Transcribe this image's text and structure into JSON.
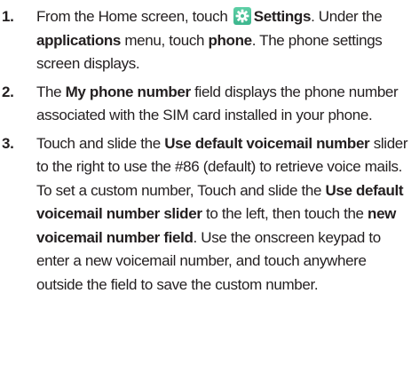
{
  "steps": [
    {
      "number": "1.",
      "t1": "From the Home screen, touch ",
      "b1": "Settings",
      "t2": ". Under the ",
      "b2": "applications",
      "t3": " menu, touch ",
      "b3": "phone",
      "t4": ". The phone settings screen displays."
    },
    {
      "number": "2.",
      "t1": "The ",
      "b1": "My phone number",
      "t2": " field displays the phone number associated with the SIM card installed in your phone."
    },
    {
      "number": "3.",
      "t1": "Touch and slide the ",
      "b1": "Use default voicemail number",
      "t2": " slider to the right to use the #86 (default) to retrieve voice mails. To set a custom number, Touch and slide the ",
      "b2": "Use default voicemail number slider",
      "t3": " to the left, then touch the ",
      "b3": "new voicemail number field",
      "t4": ". Use the onscreen keypad to enter a new voicemail number, and touch anywhere outside the field to save the custom number."
    }
  ],
  "icons": {
    "settings": "gear-icon",
    "settings_color": "#4cc49a"
  }
}
